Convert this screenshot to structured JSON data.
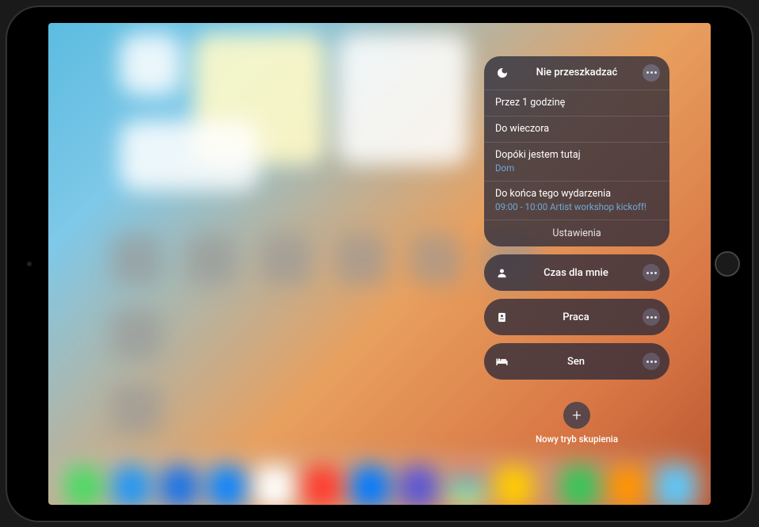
{
  "focus": {
    "dnd": {
      "title": "Nie przeszkadzać",
      "options": [
        {
          "label": "Przez 1 godzinę"
        },
        {
          "label": "Do wieczora"
        },
        {
          "label": "Dopóki jestem tutaj",
          "sub": "Dom"
        },
        {
          "label": "Do końca tego wydarzenia",
          "sub": "09:00 - 10:00 Artist workshop kickoff!"
        }
      ],
      "settings": "Ustawienia"
    },
    "modes": [
      {
        "label": "Czas dla mnie",
        "icon": "person"
      },
      {
        "label": "Praca",
        "icon": "badge"
      },
      {
        "label": "Sen",
        "icon": "bed"
      }
    ],
    "add": {
      "label": "Nowy tryb skupienia"
    }
  },
  "dock_colors": [
    "#4cd964",
    "#2196f3",
    "#1a73e8",
    "#0a84ff",
    "#ffffff",
    "#ff3b30",
    "#007aff",
    "#5856d6",
    "#ffffff",
    "#ffcc00",
    "#34c759",
    "#ff9500",
    "#5ac8fa"
  ]
}
